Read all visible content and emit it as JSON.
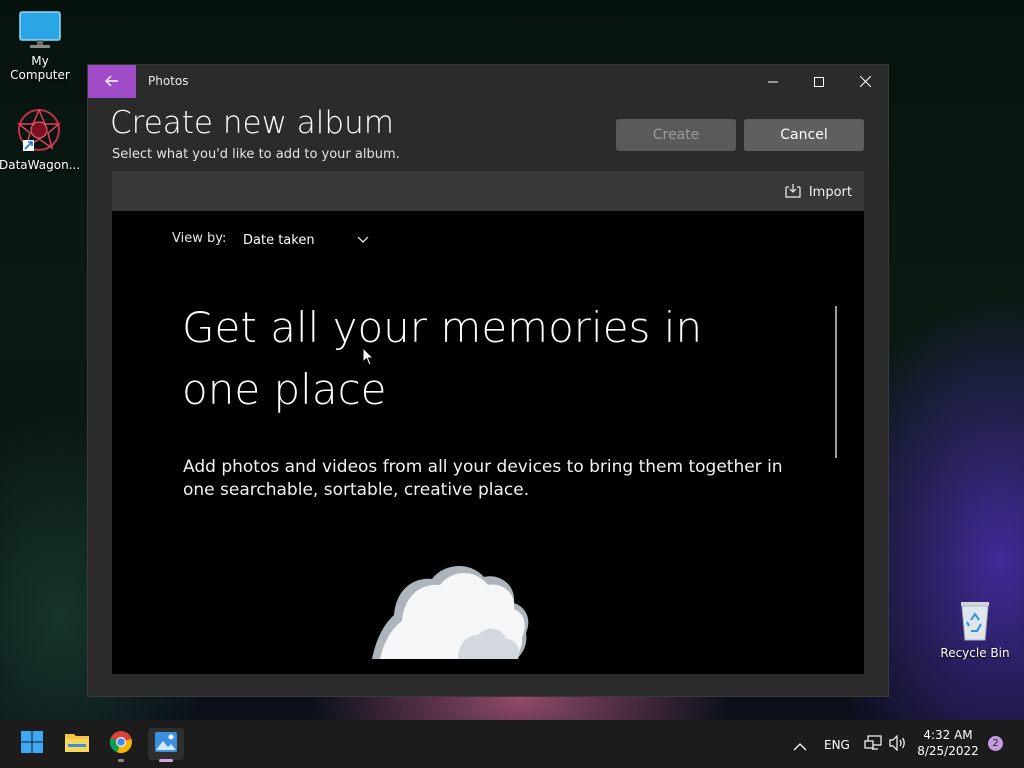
{
  "desktop": {
    "icons": [
      {
        "label": "My Computer"
      },
      {
        "label": "DataWagon..."
      },
      {
        "label": "Recycle Bin"
      }
    ]
  },
  "window": {
    "app_title": "Photos",
    "heading": "Create new album",
    "subheading": "Select what you'd like to add to your album.",
    "create_label": "Create",
    "cancel_label": "Cancel",
    "import_label": "Import",
    "view_by_label": "View by:",
    "view_by_value": "Date taken",
    "hero_title": "Get all your memories in one place",
    "hero_description": "Add photos and videos from all your devices to bring them together in one searchable, sortable, creative place."
  },
  "taskbar": {
    "language": "ENG",
    "time": "4:32 AM",
    "date": "8/25/2022",
    "notification_count": "2"
  },
  "colors": {
    "accent": "#a04bc8",
    "window_bg": "#2b2b2b",
    "content_bg": "#000000"
  }
}
